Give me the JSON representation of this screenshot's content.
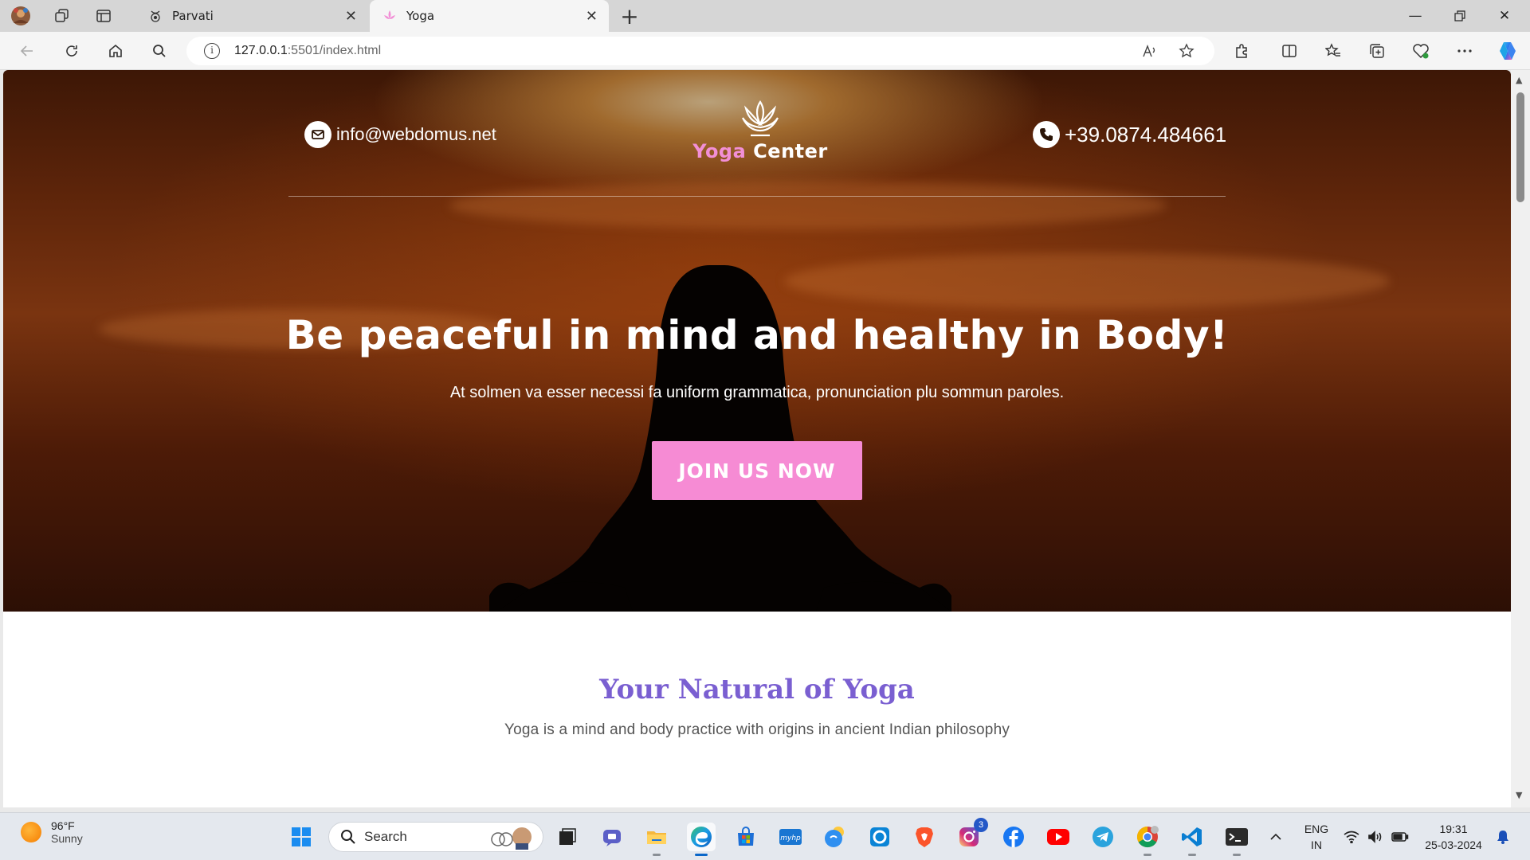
{
  "browser": {
    "tabs": [
      {
        "title": "Parvati",
        "active": false
      },
      {
        "title": "Yoga",
        "active": true
      }
    ],
    "address": {
      "host": "127.0.0.1",
      "rest": ":5501/index.html"
    }
  },
  "page": {
    "header": {
      "email": "info@webdomus.net",
      "phone": "+39.0874.484661",
      "logo_word1": "Yoga",
      "logo_word2": "Center"
    },
    "hero": {
      "headline": "Be peaceful in mind and healthy in Body!",
      "subtext": "At solmen va esser necessi fa uniform grammatica, pronunciation plu sommun paroles.",
      "cta_label": "JOIN US NOW"
    },
    "section": {
      "title": "Your Natural of Yoga",
      "subtitle": "Yoga is a mind and body practice with origins in ancient Indian philosophy"
    }
  },
  "taskbar": {
    "weather_temp": "96°F",
    "weather_desc": "Sunny",
    "search_label": "Search",
    "instagram_badge": "3",
    "lang_line1": "ENG",
    "lang_line2": "IN",
    "time": "19:31",
    "date": "25-03-2024"
  },
  "colors": {
    "accent_pink": "#f68bd4",
    "section_title": "#7a5fd1"
  }
}
